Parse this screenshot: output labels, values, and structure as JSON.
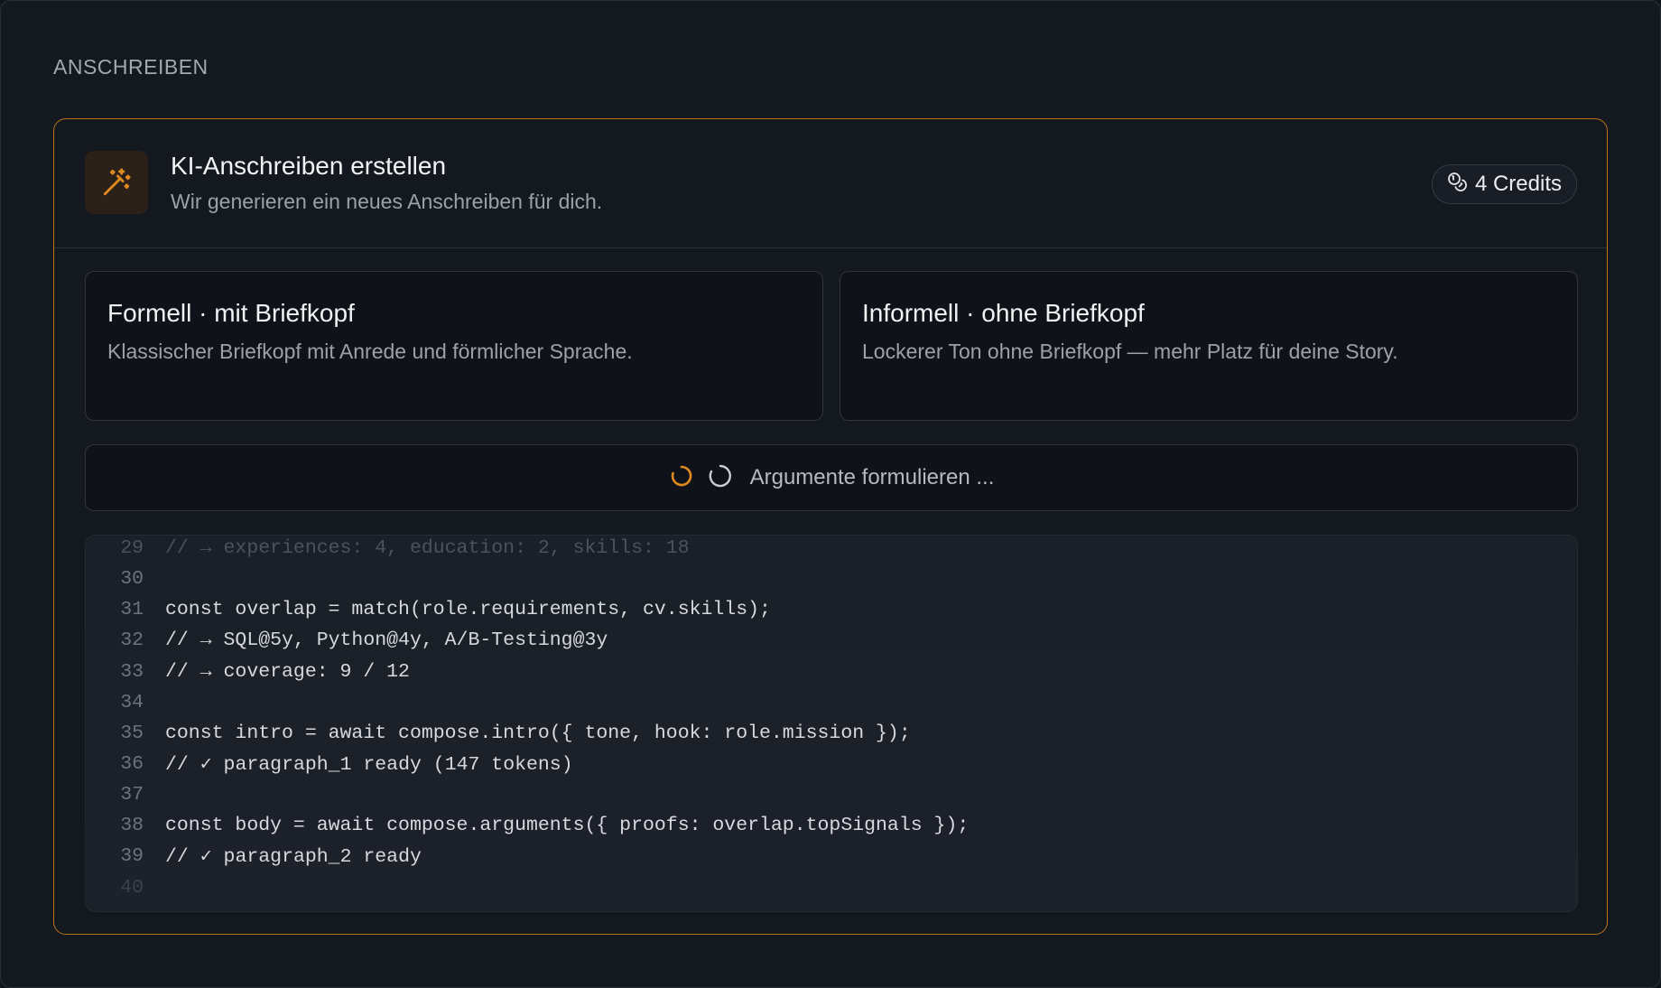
{
  "section": {
    "title": "ANSCHREIBEN"
  },
  "generator": {
    "title": "KI-Anschreiben erstellen",
    "subtitle": "Wir generieren ein neues Anschreiben für dich.",
    "icon": "magic-wand-icon",
    "credits_label": "4 Credits",
    "credits_icon": "coins-icon",
    "accent_color": "#e08a1e"
  },
  "options": [
    {
      "title": "Formell · mit Briefkopf",
      "description": "Klassischer Briefkopf mit Anrede und förmlicher Sprache."
    },
    {
      "title": "Informell · ohne Briefkopf",
      "description": "Lockerer Ton ohne Briefkopf — mehr Platz für deine Story."
    }
  ],
  "status": {
    "text": "Argumente formulieren ...",
    "icon": "spinner-icon"
  },
  "code": {
    "lines": [
      {
        "n": "29",
        "text": "// → experiences: 4, education: 2, skills: 18"
      },
      {
        "n": "30",
        "text": ""
      },
      {
        "n": "31",
        "text": "const overlap = match(role.requirements, cv.skills);"
      },
      {
        "n": "32",
        "text": "// → SQL@5y, Python@4y, A/B-Testing@3y"
      },
      {
        "n": "33",
        "text": "// → coverage: 9 / 12"
      },
      {
        "n": "34",
        "text": ""
      },
      {
        "n": "35",
        "text": "const intro = await compose.intro({ tone, hook: role.mission });"
      },
      {
        "n": "36",
        "text": "// ✓ paragraph_1 ready (147 tokens)"
      },
      {
        "n": "37",
        "text": ""
      },
      {
        "n": "38",
        "text": "const body = await compose.arguments({ proofs: overlap.topSignals });"
      },
      {
        "n": "39",
        "text": "// ✓ paragraph_2 ready"
      },
      {
        "n": "40",
        "text": ""
      }
    ]
  }
}
